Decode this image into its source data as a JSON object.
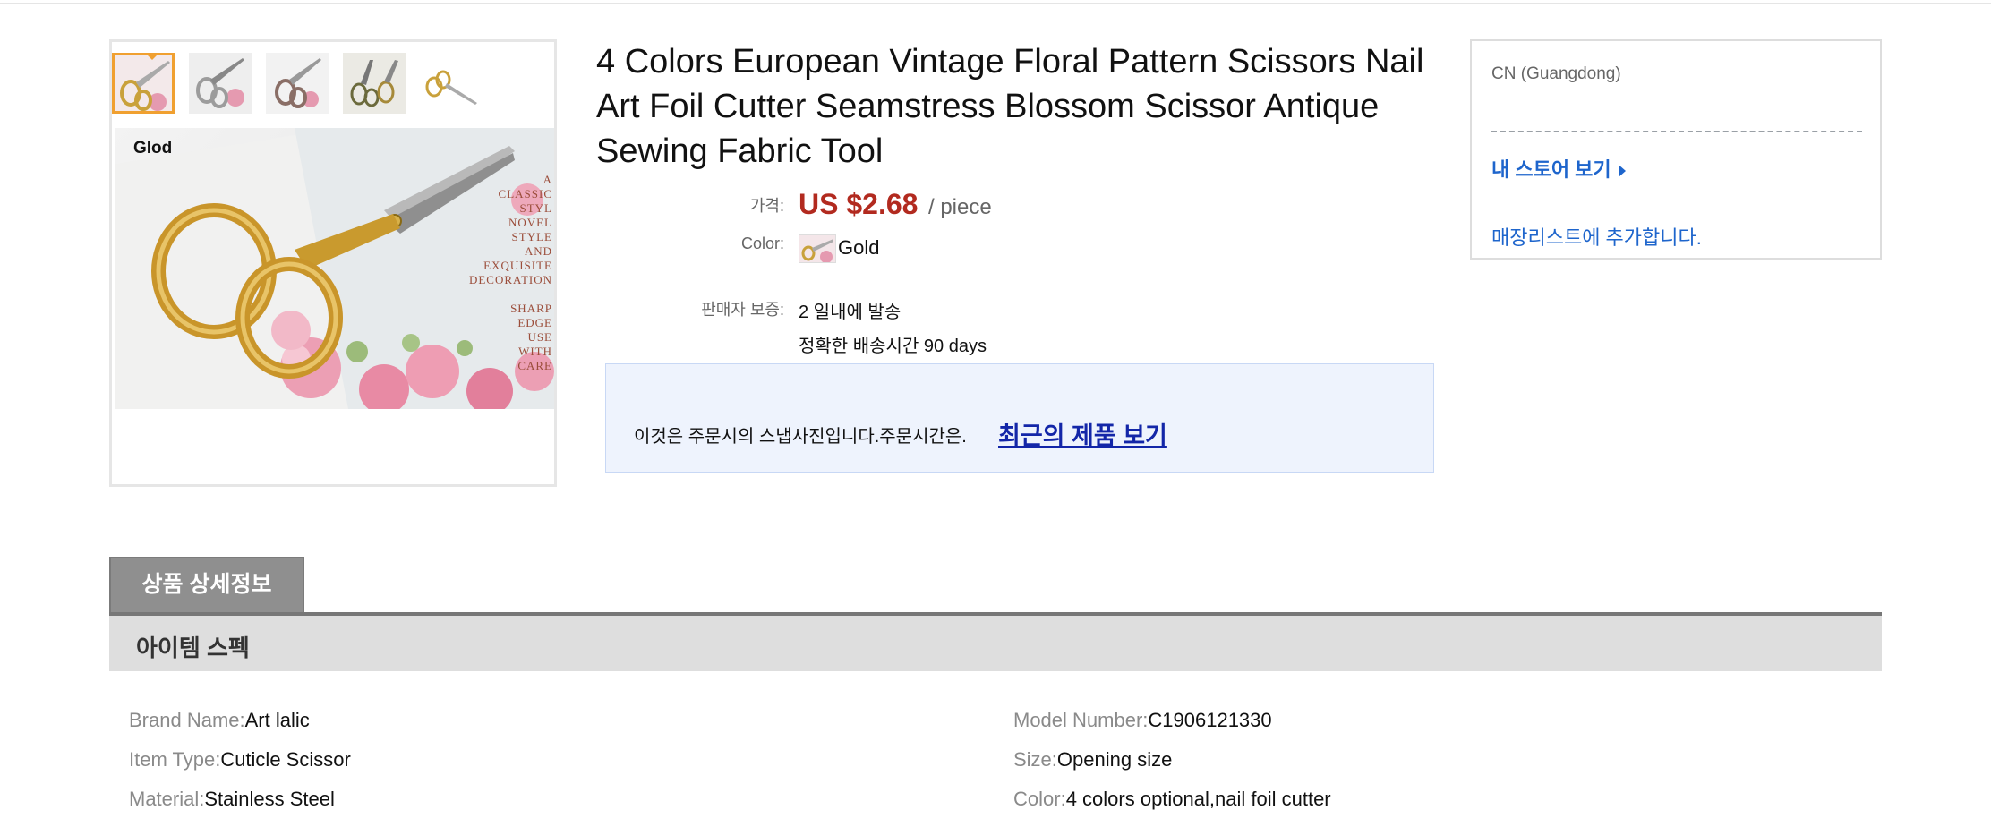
{
  "gallery": {
    "image_label": "Glod",
    "tag_lines": [
      "A",
      "CLASSIC",
      "STYL",
      "NOVEL",
      "STYLE",
      "AND",
      "EXQUISITE",
      "DECORATION",
      "",
      "SHARP",
      "EDGE",
      "USE",
      "WITH",
      "CARE"
    ]
  },
  "product": {
    "title": "4 Colors European Vintage Floral Pattern Scissors Nail Art Foil Cutter Seamstress Blossom Scissor Antique Sewing Fabric Tool",
    "price_label": "가격:",
    "price": "US $2.68",
    "unit": "/ piece",
    "color_label": "Color:",
    "color_value": "Gold",
    "warranty_label": "판매자 보증:",
    "ship_line1": "2 일내에 발송",
    "ship_line2": "정확한 배송시간 90 days",
    "snapshot_text": "이것은 주문시의 스냅사진입니다.주문시간은.",
    "snapshot_link": "최근의 제품 보기"
  },
  "store": {
    "location": "CN (Guangdong)",
    "view_store": "내 스토어 보기",
    "add_wishlist": "매장리스트에 추가합니다."
  },
  "details": {
    "tab_label": "상품 상세정보",
    "spec_header": "아이템 스펙",
    "specs_left": [
      {
        "key": "Brand Name:",
        "value": "Art lalic"
      },
      {
        "key": "Item Type:",
        "value": "Cuticle Scissor"
      },
      {
        "key": "Material:",
        "value": "Stainless Steel"
      }
    ],
    "specs_right": [
      {
        "key": "Model Number:",
        "value": "C1906121330"
      },
      {
        "key": "Size:",
        "value": "Opening size"
      },
      {
        "key": "Color:",
        "value": "4 colors optional,nail foil cutter"
      }
    ]
  }
}
